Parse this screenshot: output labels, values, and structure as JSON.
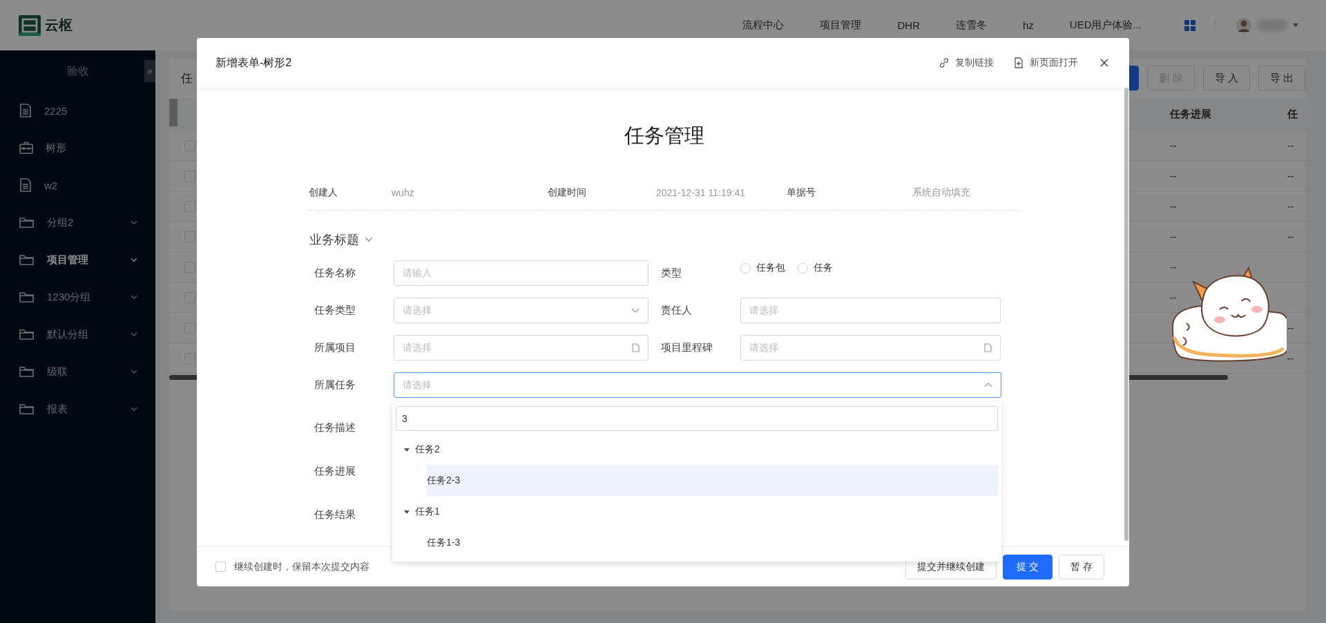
{
  "header": {
    "logo_text": "云枢",
    "nav": [
      "流程中心",
      "项目管理",
      "DHR",
      "连雪冬",
      "hz",
      "UED用户体验..."
    ]
  },
  "sidebar": {
    "title": "验收",
    "collapse_glyph": "«",
    "items": [
      {
        "label": "2225",
        "kind": "doc",
        "selected": false
      },
      {
        "label": "树形",
        "kind": "toolbox",
        "selected": false
      },
      {
        "label": "w2",
        "kind": "doc",
        "selected": false
      },
      {
        "label": "分组2",
        "kind": "folder",
        "selected": false
      },
      {
        "label": "项目管理",
        "kind": "folder",
        "selected": true
      },
      {
        "label": "1230分组",
        "kind": "folder",
        "selected": false
      },
      {
        "label": "默认分组",
        "kind": "folder",
        "selected": false
      },
      {
        "label": "级联",
        "kind": "folder",
        "selected": false
      },
      {
        "label": "报表",
        "kind": "folder",
        "selected": false
      }
    ]
  },
  "content": {
    "title": "任",
    "buttons": [
      {
        "kind": "primary"
      },
      {
        "kind": "default",
        "label": "删 除",
        "disabled": true
      },
      {
        "kind": "default",
        "label": "导 入",
        "disabled": false
      },
      {
        "kind": "default",
        "label": "导 出",
        "disabled": false
      }
    ],
    "table": {
      "columns": [
        "任务进展",
        "任"
      ],
      "rows": [
        {
          "checked": false,
          "task_progress": "--",
          "column_2": "--"
        },
        {
          "checked": false,
          "task_progress": "--",
          "column_2": "--"
        },
        {
          "checked": false,
          "task_progress": "--",
          "column_2": "--"
        },
        {
          "checked": false,
          "task_progress": "--",
          "column_2": "--"
        },
        {
          "checked": false,
          "task_progress": "--"
        },
        {
          "checked": false,
          "task_progress": "--"
        },
        {
          "checked": false,
          "column_2": "--"
        },
        {
          "checked": false,
          "column_2": "--"
        }
      ]
    }
  },
  "dialog": {
    "title": "新增表单-树形2",
    "actions": [
      {
        "kind": "link",
        "label": "复制链接"
      },
      {
        "kind": "new_page",
        "label": "新页面打开"
      }
    ],
    "form_title": "任务管理",
    "meta": [
      {
        "label": "创建人",
        "value": "wuhz"
      },
      {
        "label": "创建时间",
        "value": "2021-12-31 11:19:41"
      },
      {
        "label": "单据号",
        "value": "系统自动填充"
      }
    ],
    "section": {
      "title": "业务标题",
      "expanded": true
    },
    "rows": [
      [
        {
          "label": "任务名称",
          "kind": "text",
          "placeholder": "请输入"
        },
        {
          "label": "类型",
          "kind": "radio",
          "options": [
            {
              "label": "任务包",
              "checked": false
            },
            {
              "label": "任务",
              "checked": false
            }
          ]
        }
      ],
      [
        {
          "label": "任务类型",
          "kind": "select",
          "placeholder": "请选择"
        },
        {
          "label": "责任人",
          "kind": "text",
          "placeholder": "请选择"
        }
      ],
      [
        {
          "label": "所属项目",
          "kind": "picker",
          "placeholder": "请选择"
        },
        {
          "label": "项目里程碑",
          "kind": "picker",
          "placeholder": "请选择"
        }
      ],
      [
        {
          "label": "所属任务",
          "kind": "tree_select",
          "placeholder": "请选择",
          "expanded": true
        }
      ],
      [
        {
          "label": "任务描述"
        }
      ],
      [
        {
          "label": "任务进展"
        }
      ],
      [
        {
          "label": "任务结果"
        }
      ]
    ],
    "dropdown": {
      "search_value": "3",
      "tree": [
        {
          "label": "任务2",
          "expanded": true,
          "selected": false,
          "children": [
            {
              "label": "任务2-3",
              "selected": true
            }
          ]
        },
        {
          "label": "任务1",
          "expanded": true,
          "selected": false,
          "children": [
            {
              "label": "任务1-3",
              "selected": false
            }
          ]
        }
      ]
    },
    "footer": {
      "keep_checkbox": {
        "label": "继续创建时，保留本次提交内容",
        "checked": false
      },
      "buttons": [
        {
          "kind": "default",
          "label": "提交并继续创建"
        },
        {
          "kind": "primary",
          "label": "提 交"
        },
        {
          "kind": "default",
          "label": "暂 存"
        }
      ]
    }
  }
}
